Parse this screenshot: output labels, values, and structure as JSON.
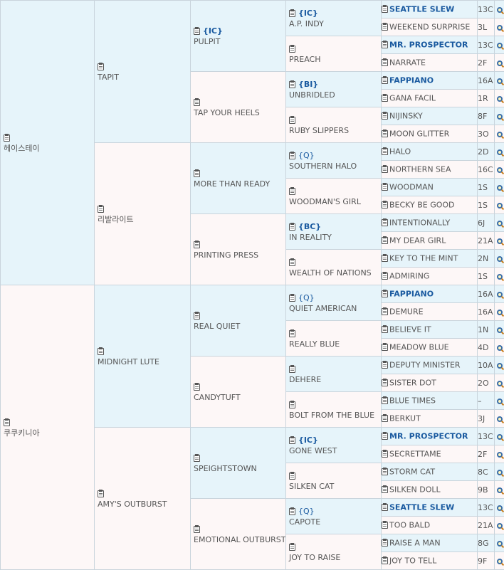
{
  "pedigree": {
    "g1": [
      {
        "name": "헤이스테이"
      },
      {
        "name": "쿠쿠키니아"
      }
    ],
    "g2": [
      {
        "name": "TAPIT"
      },
      {
        "name": "리발라이트"
      },
      {
        "name": "MIDNIGHT LUTE"
      },
      {
        "name": "AMY'S OUTBURST"
      }
    ],
    "g3": [
      {
        "name": "PULPIT",
        "tag": "{IC}"
      },
      {
        "name": "TAP YOUR HEELS"
      },
      {
        "name": "MORE THAN READY"
      },
      {
        "name": "PRINTING PRESS"
      },
      {
        "name": "REAL QUIET"
      },
      {
        "name": "CANDYTUFT"
      },
      {
        "name": "SPEIGHTSTOWN"
      },
      {
        "name": "EMOTIONAL OUTBURST"
      }
    ],
    "g4": [
      {
        "name": "A.P. INDY",
        "tag": "{IC}"
      },
      {
        "name": "PREACH"
      },
      {
        "name": "UNBRIDLED",
        "tag": "{BI}"
      },
      {
        "name": "RUBY SLIPPERS"
      },
      {
        "name": "SOUTHERN HALO",
        "tag": "{Q}"
      },
      {
        "name": "WOODMAN'S GIRL"
      },
      {
        "name": "IN REALITY",
        "tag": "{BC}"
      },
      {
        "name": "WEALTH OF NATIONS"
      },
      {
        "name": "QUIET AMERICAN",
        "tag": "{Q}"
      },
      {
        "name": "REALLY BLUE"
      },
      {
        "name": "DEHERE"
      },
      {
        "name": "BOLT FROM THE BLUE"
      },
      {
        "name": "GONE WEST",
        "tag": "{IC}"
      },
      {
        "name": "SILKEN CAT"
      },
      {
        "name": "CAPOTE",
        "tag": "{Q}"
      },
      {
        "name": "JOY TO RAISE"
      }
    ],
    "g5": [
      {
        "name": "SEATTLE SLEW",
        "code": "13C",
        "bold": true
      },
      {
        "name": "WEEKEND SURPRISE",
        "code": "3L"
      },
      {
        "name": "MR. PROSPECTOR",
        "code": "13C",
        "bold": true
      },
      {
        "name": "NARRATE",
        "code": "2F"
      },
      {
        "name": "FAPPIANO",
        "code": "16A",
        "bold": true
      },
      {
        "name": "GANA FACIL",
        "code": "1R"
      },
      {
        "name": "NIJINSKY",
        "code": "8F"
      },
      {
        "name": "MOON GLITTER",
        "code": "3O"
      },
      {
        "name": "HALO",
        "code": "2D"
      },
      {
        "name": "NORTHERN SEA",
        "code": "16C"
      },
      {
        "name": "WOODMAN",
        "code": "1S"
      },
      {
        "name": "BECKY BE GOOD",
        "code": "1S"
      },
      {
        "name": "INTENTIONALLY",
        "code": "6J"
      },
      {
        "name": "MY DEAR GIRL",
        "code": "21A"
      },
      {
        "name": "KEY TO THE MINT",
        "code": "2N"
      },
      {
        "name": "ADMIRING",
        "code": "1S"
      },
      {
        "name": "FAPPIANO",
        "code": "16A",
        "bold": true
      },
      {
        "name": "DEMURE",
        "code": "16A"
      },
      {
        "name": "BELIEVE IT",
        "code": "1N"
      },
      {
        "name": "MEADOW BLUE",
        "code": "4D"
      },
      {
        "name": "DEPUTY MINISTER",
        "code": "10A"
      },
      {
        "name": "SISTER DOT",
        "code": "2O"
      },
      {
        "name": "BLUE TIMES",
        "code": "–"
      },
      {
        "name": "BERKUT",
        "code": "3J"
      },
      {
        "name": "MR. PROSPECTOR",
        "code": "13C",
        "bold": true
      },
      {
        "name": "SECRETTAME",
        "code": "2F"
      },
      {
        "name": "STORM CAT",
        "code": "8C"
      },
      {
        "name": "SILKEN DOLL",
        "code": "9B"
      },
      {
        "name": "SEATTLE SLEW",
        "code": "13C",
        "bold": true
      },
      {
        "name": "TOO BALD",
        "code": "21A"
      },
      {
        "name": "RAISE A MAN",
        "code": "8G"
      },
      {
        "name": "JOY TO TELL",
        "code": "9F"
      }
    ]
  },
  "icons": {
    "doc": "clipboard-icon",
    "search": "magnifier-icon"
  }
}
